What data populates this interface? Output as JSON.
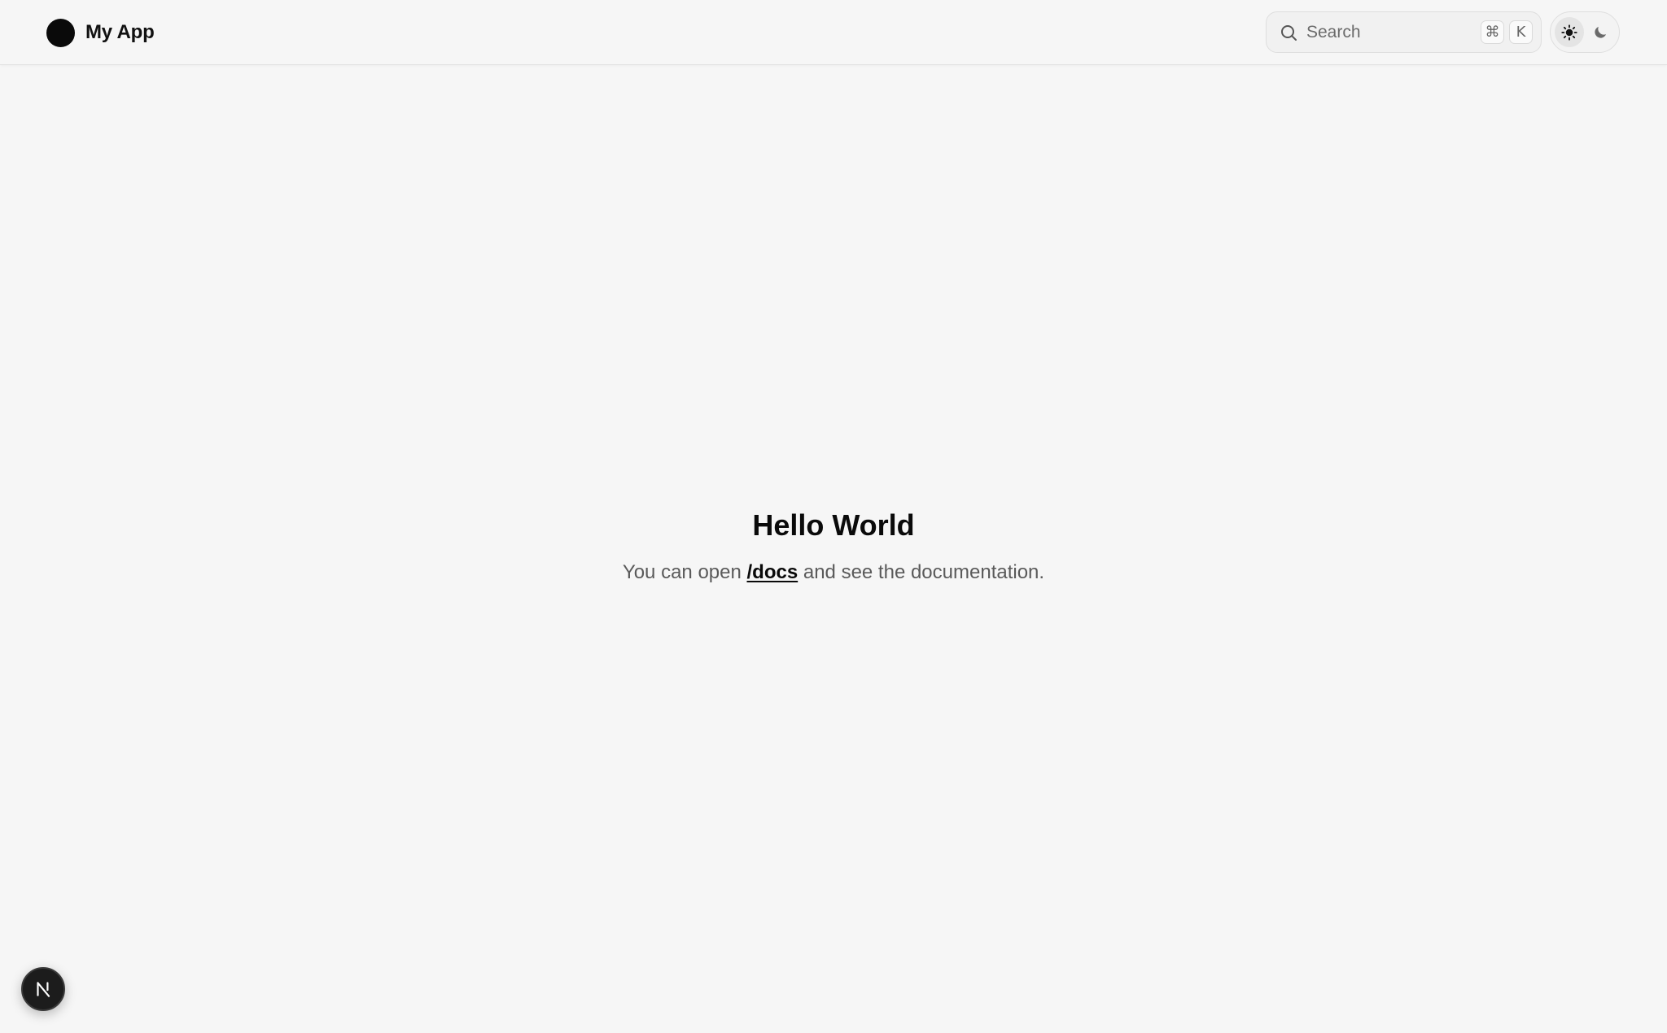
{
  "navbar": {
    "brand_name": "My App",
    "search": {
      "placeholder": "Search",
      "shortcut_keys": [
        "⌘",
        "K"
      ]
    },
    "theme_toggle": {
      "options": [
        "light",
        "dark"
      ],
      "selected": "light"
    }
  },
  "main": {
    "title": "Hello World",
    "text_before": "You can open ",
    "link_label": "/docs",
    "text_after": " and see the documentation."
  },
  "dev_badge": {
    "label": "N"
  },
  "colors": {
    "background": "#f6f6f6",
    "text": "#0a0a0a",
    "muted_text": "#5a5a5a",
    "badge_background": "#1c1c1c"
  },
  "icons": {
    "brand": "circle-logo-icon",
    "search": "search-icon",
    "light": "sun-icon",
    "dark": "moon-icon",
    "dev_badge": "nextjs-logo-icon"
  }
}
